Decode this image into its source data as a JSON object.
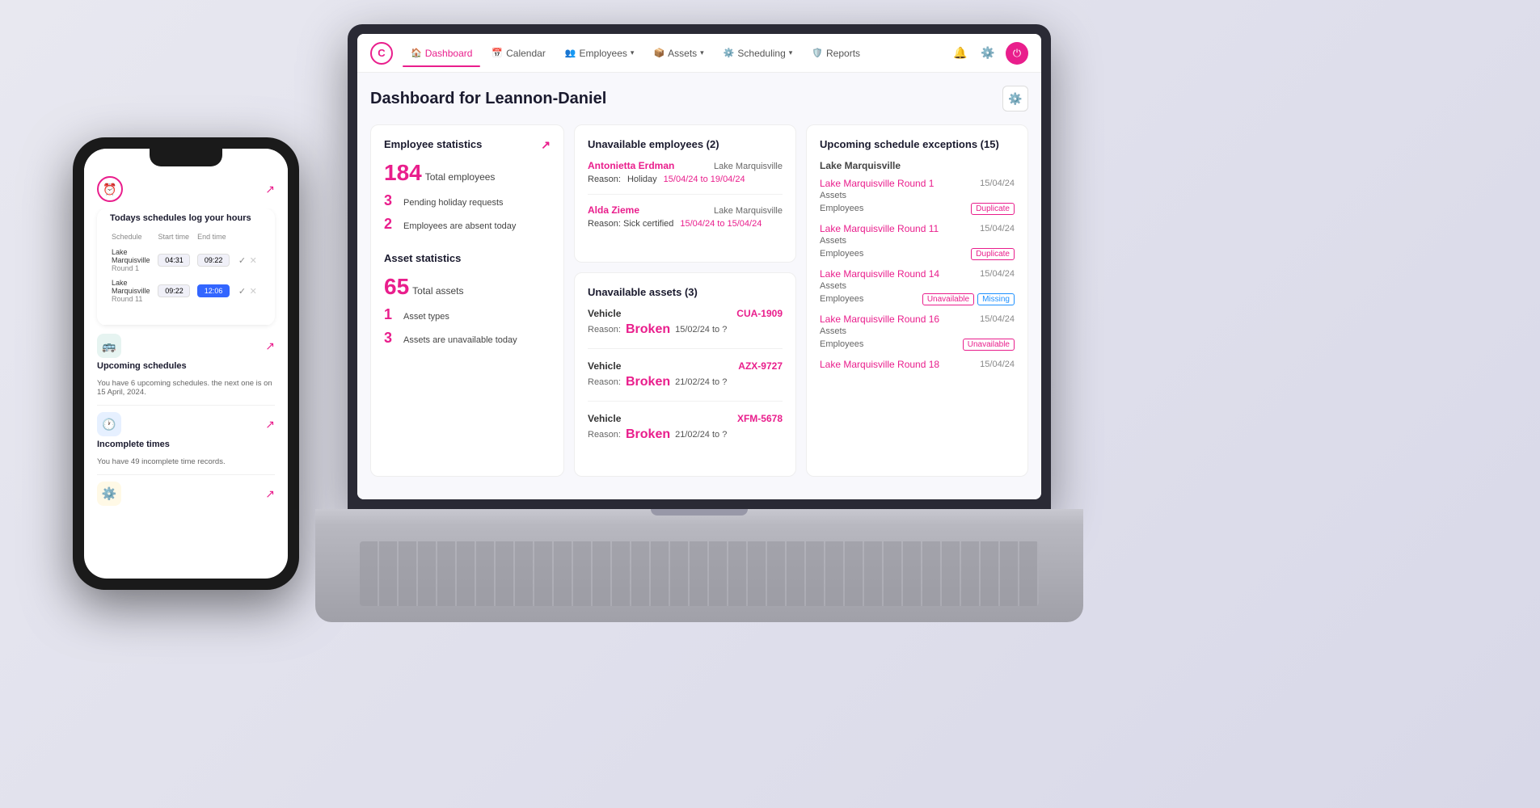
{
  "scene": {
    "background": "#e8e8f0"
  },
  "nav": {
    "logo": "C",
    "items": [
      {
        "label": "Dashboard",
        "icon": "🏠",
        "active": true
      },
      {
        "label": "Calendar",
        "icon": "📅",
        "active": false
      },
      {
        "label": "Employees",
        "icon": "👥",
        "active": false,
        "has_dropdown": true
      },
      {
        "label": "Assets",
        "icon": "📦",
        "active": false,
        "has_dropdown": true
      },
      {
        "label": "Scheduling",
        "icon": "⚙️",
        "active": false,
        "has_dropdown": true
      },
      {
        "label": "Reports",
        "icon": "🛡️",
        "active": false
      }
    ]
  },
  "dashboard": {
    "title": "Dashboard for Leannon-Daniel",
    "employee_stats": {
      "card_title": "Employee statistics",
      "total_count": "184",
      "total_label": "Total employees",
      "pending_count": "3",
      "pending_label": "Pending holiday requests",
      "absent_count": "2",
      "absent_label": "Employees are absent today"
    },
    "unavailable_employees": {
      "card_title": "Unavailable employees (2)",
      "employees": [
        {
          "name": "Antonietta Erdman",
          "location": "Lake Marquisville",
          "reason_label": "Reason:",
          "reason": "Holiday",
          "date_range": "15/04/24 to 19/04/24"
        },
        {
          "name": "Alda Zieme",
          "location": "Lake Marquisville",
          "reason_label": "Reason: Sick certified",
          "date_range": "15/04/24 to 15/04/24"
        }
      ]
    },
    "schedule_exceptions": {
      "card_title": "Upcoming schedule exceptions (15)",
      "location": "Lake Marquisville",
      "items": [
        {
          "name": "Lake Marquisville Round 1",
          "date": "15/04/24",
          "sub1": "Assets",
          "sub2": "Employees",
          "tags": [
            "Duplicate"
          ]
        },
        {
          "name": "Lake Marquisville Round 11",
          "date": "15/04/24",
          "sub1": "Assets",
          "sub2": "Employees",
          "tags": [
            "Duplicate"
          ]
        },
        {
          "name": "Lake Marquisville Round 14",
          "date": "15/04/24",
          "sub1": "Assets",
          "sub2": "Employees",
          "tags": [
            "Unavailable",
            "Missing"
          ]
        },
        {
          "name": "Lake Marquisville Round 16",
          "date": "15/04/24",
          "sub1": "Assets",
          "sub2": "Employees",
          "tags": [
            "Unavailable"
          ]
        },
        {
          "name": "Lake Marquisville Round 18",
          "date": "15/04/24",
          "sub1": "",
          "sub2": "",
          "tags": []
        }
      ]
    },
    "asset_stats": {
      "card_title": "Asset statistics",
      "total_count": "65",
      "total_label": "Total assets",
      "types_count": "1",
      "types_label": "Asset types",
      "unavail_count": "3",
      "unavail_label": "Assets are unavailable today"
    },
    "unavailable_assets": {
      "card_title": "Unavailable assets (3)",
      "assets": [
        {
          "type": "Vehicle",
          "id": "CUA-1909",
          "reason": "Broken",
          "date_range": "15/02/24 to ?"
        },
        {
          "type": "Vehicle",
          "id": "AZX-9727",
          "reason": "Broken",
          "date_range": "21/02/24 to ?"
        },
        {
          "type": "Vehicle",
          "id": "XFM-5678",
          "reason": "Broken",
          "date_range": "21/02/24 to ?"
        }
      ]
    }
  },
  "phone": {
    "section1": {
      "title": "Todays schedules log your hours",
      "table_headers": [
        "Schedule",
        "Start time",
        "End time"
      ],
      "rows": [
        {
          "location": "Lake Marquisville",
          "round": "Round 1",
          "start": "04:31",
          "end": "09:22"
        },
        {
          "location": "Lake Marquisville",
          "round": "Round 11",
          "start": "09:22",
          "end": "12:06"
        }
      ]
    },
    "section2": {
      "icon": "🚌",
      "icon_color": "#e6f4f1",
      "title": "Upcoming schedules",
      "text": "You have 6 upcoming schedules. the next one is on 15 April, 2024."
    },
    "section3": {
      "icon": "🕐",
      "icon_color": "#e6f0ff",
      "title": "Incomplete times",
      "text": "You have 49 incomplete time records."
    },
    "section4": {
      "icon": "⚙️",
      "icon_color": "#fff9e6"
    }
  }
}
